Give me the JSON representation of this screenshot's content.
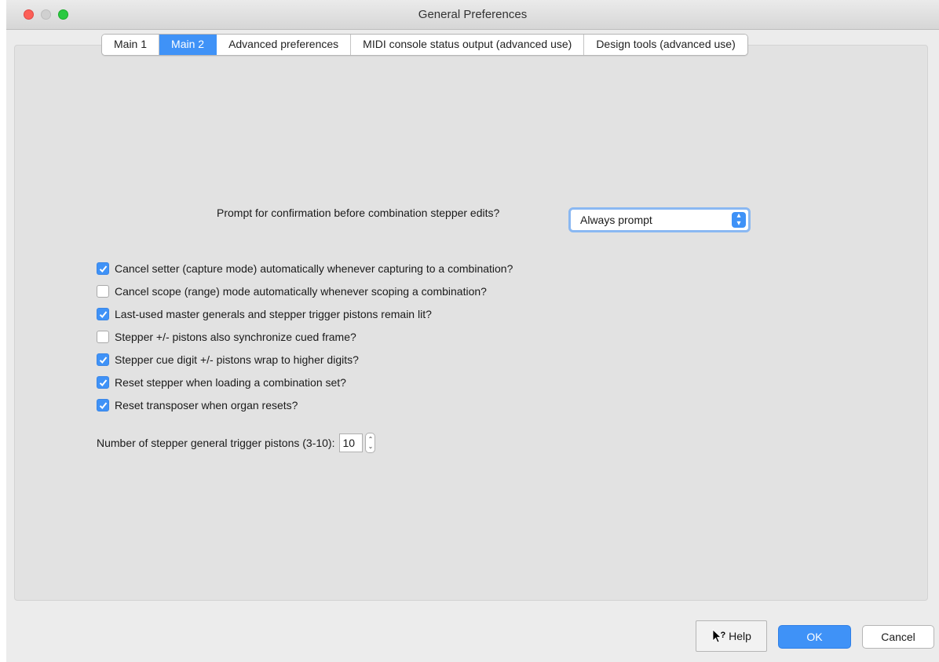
{
  "window": {
    "title": "General Preferences"
  },
  "tabs": [
    {
      "label": "Main 1",
      "active": false
    },
    {
      "label": "Main 2",
      "active": true
    },
    {
      "label": "Advanced preferences",
      "active": false
    },
    {
      "label": "MIDI console status output (advanced use)",
      "active": false
    },
    {
      "label": "Design tools (advanced use)",
      "active": false
    }
  ],
  "prompt": {
    "label": "Prompt for confirmation before combination stepper edits?",
    "value": "Always prompt"
  },
  "options": [
    {
      "label": "Cancel setter (capture mode) automatically whenever capturing to a combination?",
      "checked": true
    },
    {
      "label": "Cancel scope (range) mode automatically whenever scoping a combination?",
      "checked": false
    },
    {
      "label": "Last-used master generals and stepper trigger pistons remain lit?",
      "checked": true
    },
    {
      "label": "Stepper +/- pistons also synchronize cued frame?",
      "checked": false
    },
    {
      "label": "Stepper cue digit +/- pistons wrap to higher digits?",
      "checked": true
    },
    {
      "label": "Reset stepper when loading a combination set?",
      "checked": true
    },
    {
      "label": "Reset transposer when organ resets?",
      "checked": true
    }
  ],
  "stepper_count": {
    "label": "Number of stepper general trigger pistons (3-10):",
    "value": "10"
  },
  "buttons": {
    "help": "Help",
    "ok": "OK",
    "cancel": "Cancel"
  },
  "colors": {
    "accent": "#3f92f7",
    "panel": "#e2e2e2"
  }
}
